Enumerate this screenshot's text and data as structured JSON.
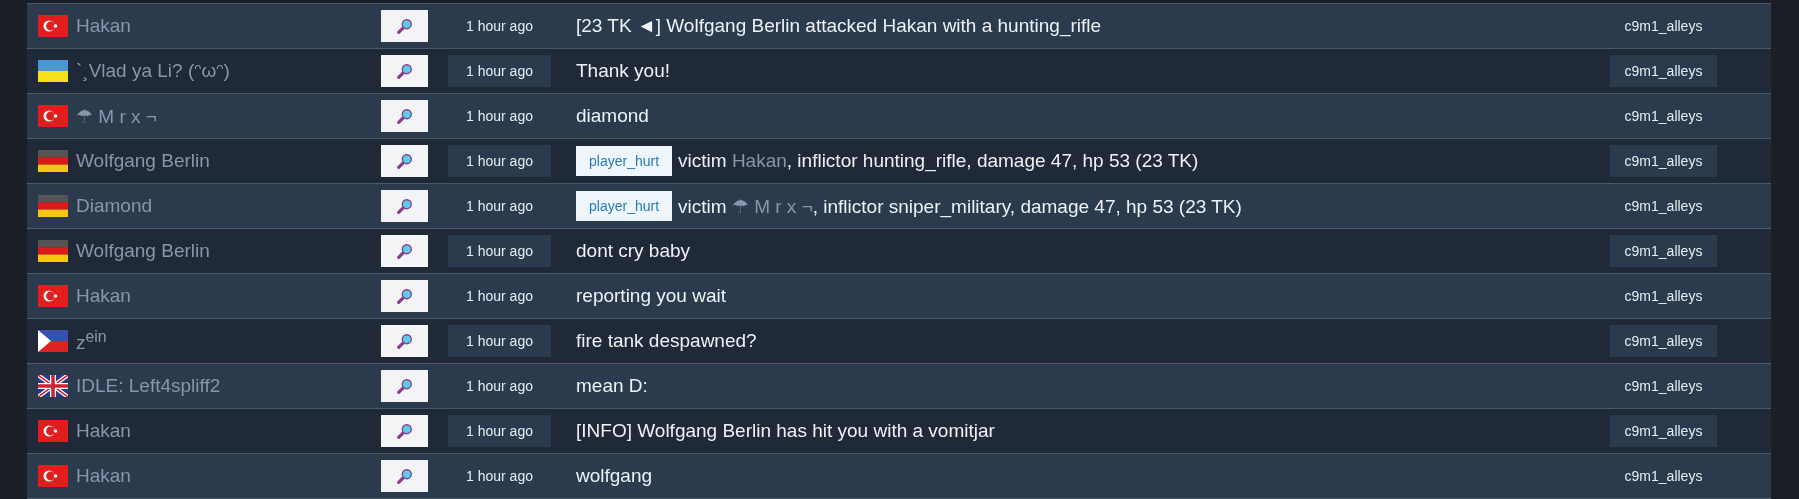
{
  "rows": [
    {
      "kind": "turkey",
      "name": "Hakan",
      "time": "1 hour ago",
      "message": [
        {
          "text": "[23 TK ◄] Wolfgang Berlin attacked Hakan with a hunting_rifle"
        }
      ],
      "map": "c9m1_alleys"
    },
    {
      "kind": "ukraine",
      "name": "`¸Vlad ya Li? (ᵔωᵔ)",
      "time": "1 hour ago",
      "message": [
        {
          "text": "Thank you!"
        }
      ],
      "map": "c9m1_alleys"
    },
    {
      "kind": "turkey",
      "name": "☂ M r x ¬",
      "time": "1 hour ago",
      "message": [
        {
          "text": "diamond"
        }
      ],
      "map": "c9m1_alleys"
    },
    {
      "kind": "germany",
      "name": "Wolfgang Berlin",
      "time": "1 hour ago",
      "tag": "player_hurt",
      "message": [
        {
          "text": "victim "
        },
        {
          "text": "Hakan",
          "kind": "player"
        },
        {
          "text": ", inflictor hunting_rifle, damage 47, hp 53 (23 TK)"
        }
      ],
      "map": "c9m1_alleys"
    },
    {
      "kind": "germany",
      "name": "Diamond",
      "time": "1 hour ago",
      "tag": "player_hurt",
      "message": [
        {
          "text": "victim "
        },
        {
          "text": "☂ M r x ¬",
          "kind": "player"
        },
        {
          "text": ", inflictor sniper_military, damage 47, hp 53 (23 TK)"
        }
      ],
      "map": "c9m1_alleys"
    },
    {
      "kind": "germany",
      "name": "Wolfgang Berlin",
      "time": "1 hour ago",
      "message": [
        {
          "text": "dont cry baby"
        }
      ],
      "map": "c9m1_alleys"
    },
    {
      "kind": "turkey",
      "name": "Hakan",
      "time": "1 hour ago",
      "message": [
        {
          "text": "reporting you wait"
        }
      ],
      "map": "c9m1_alleys"
    },
    {
      "kind": "philippines",
      "name": "z$^{ein}$",
      "time": "1 hour ago",
      "message": [
        {
          "text": "fire tank despawned?"
        }
      ],
      "map": "c9m1_alleys"
    },
    {
      "kind": "uk",
      "name": "IDLE: Left4spliff2",
      "time": "1 hour ago",
      "message": [
        {
          "text": "mean D:"
        }
      ],
      "map": "c9m1_alleys"
    },
    {
      "kind": "turkey",
      "name": "Hakan",
      "time": "1 hour ago",
      "message": [
        {
          "text": "[INFO] Wolfgang Berlin has hit you with a vomitjar"
        }
      ],
      "map": "c9m1_alleys"
    },
    {
      "kind": "turkey",
      "name": "Hakan",
      "time": "1 hour ago",
      "message": [
        {
          "text": "wolfgang"
        }
      ],
      "map": "c9m1_alleys"
    }
  ]
}
